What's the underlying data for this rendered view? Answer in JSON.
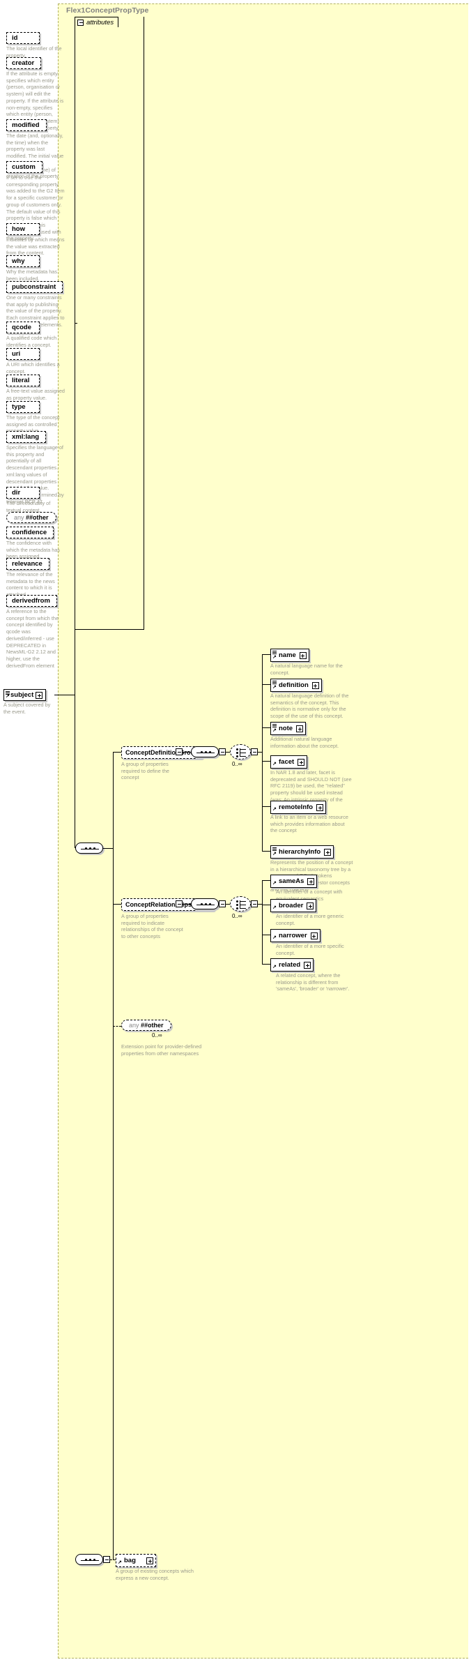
{
  "diagram": {
    "type_title": "Flex1ConceptPropType",
    "attributes_label": "attributes",
    "root_element": {
      "name": "subject",
      "description": "A subject covered by the event."
    },
    "attributes": [
      {
        "name": "id",
        "description": "The local identifier of the property."
      },
      {
        "name": "creator",
        "description": "If the attribute is empty, specifies which entity (person, organisation or system) will edit the property. If the attribute is non-empty, specifies which entity (person, organisation or system) has edited the property."
      },
      {
        "name": "modified",
        "description": "The date (and, optionally, the time) when the property was last modified. The initial value is the date (and, optionally, the time) of creation of the property."
      },
      {
        "name": "custom",
        "description": "If set to true the corresponding property was added to the G2 Item for a specific customer or group of customers only. The default value of this property is false which applies when this attribute is not used with the property."
      },
      {
        "name": "how",
        "description": "Indicates by which means the value was extracted from the content."
      },
      {
        "name": "why",
        "description": "Why the metadata has been included."
      },
      {
        "name": "pubconstraint",
        "description": "One or many constraints that apply to publishing the value of the property. Each constraint applies to all descendant elements."
      },
      {
        "name": "qcode",
        "description": "A qualified code which identifies a concept."
      },
      {
        "name": "uri",
        "description": "A URI which identifies a concept."
      },
      {
        "name": "literal",
        "description": "A free-text value assigned as property value."
      },
      {
        "name": "type",
        "description": "The type of the concept assigned as controlled property value."
      },
      {
        "name": "xml:lang",
        "description": "Specifies the language of this property and potentially of all descendant properties. xml:lang values of descendant properties override this value. Values are determined by Internet BCP 47."
      },
      {
        "name": "dir",
        "description": "The directionality of textual content."
      },
      {
        "name": "any ##other",
        "description": "",
        "is_any": true
      },
      {
        "name": "confidence",
        "description": "The confidence with which the metadata has been assigned."
      },
      {
        "name": "relevance",
        "description": "The relevance of the metadata to the news content to which it is attached."
      },
      {
        "name": "derivedfrom",
        "description": "A reference to the concept from which the concept identified by qcode was derived/inferred - use DEPRECATED in NewsML-G2 2.12 and higher, use the derivedFrom element"
      }
    ],
    "groups": [
      {
        "name": "ConceptDefinitionGroup",
        "description": "A group of properties required to define the concept",
        "occurrence": "0..∞",
        "elements": [
          {
            "name": "name",
            "description": "A natural language name for the concept."
          },
          {
            "name": "definition",
            "description": "A natural language definition of the semantics of the concept. This definition is normative only for the scope of the use of this concept."
          },
          {
            "name": "note",
            "description": "Additional natural language information about the concept."
          },
          {
            "name": "facet",
            "description": "In NAR 1.8 and later, facet is deprecated and SHOULD NOT (see RFC 2119) be used, the \"related\" property should be used instead (was: An intrinsic property of the concept.)"
          },
          {
            "name": "remoteInfo",
            "description": "A link to an item or a web resource which provides information about the concept"
          },
          {
            "name": "hierarchyInfo",
            "description": "Represents the position of a concept in a hierarchical taxonomy tree by a sequence of QCode tokens representing the ancestor concepts and this concept"
          }
        ]
      },
      {
        "name": "ConceptRelationshipsGroup",
        "description": "A group of properties required to indicate relationships of the concept to other concepts",
        "occurrence": "0..∞",
        "elements": [
          {
            "name": "sameAs",
            "description": "An identifier of a concept with equivalent semantics"
          },
          {
            "name": "broader",
            "description": "An identifier of a more generic concept."
          },
          {
            "name": "narrower",
            "description": "An identifier of a more specific concept."
          },
          {
            "name": "related",
            "description": "A related concept, where the relationship is different from 'sameAs', 'broader' or 'narrower'."
          }
        ]
      }
    ],
    "extension": {
      "label_prefix": "any",
      "label_value": "##other",
      "occurrence": "0..∞",
      "description": "Extension point for provider-defined properties from other namespaces"
    },
    "bag": {
      "name": "bag",
      "description": "A group of existing concepts which express a new concept."
    },
    "colors": {
      "canvas": "#ffffcc",
      "text_muted": "#9a9a8c",
      "title": "#808080",
      "line": "#000000"
    }
  }
}
